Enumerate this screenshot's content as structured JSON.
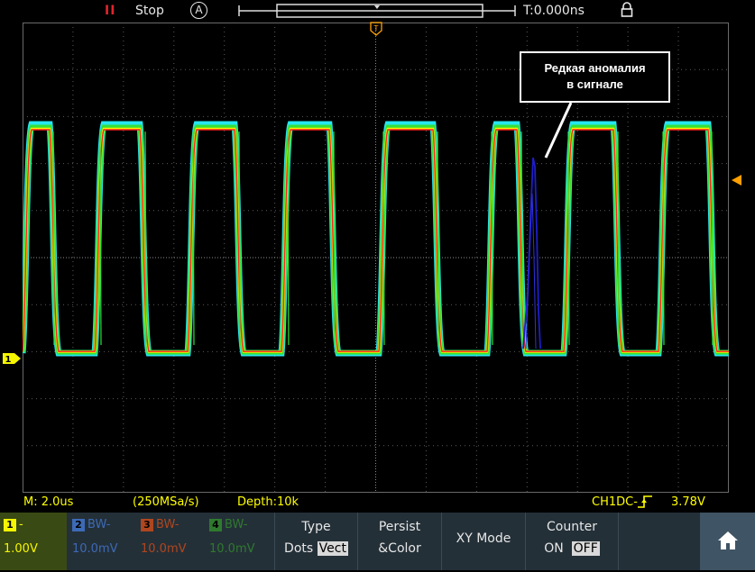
{
  "topbar": {
    "run_indicator": "II",
    "status": "Stop",
    "acq_mode": "A",
    "time_offset": "T:0.000ns",
    "lock_icon": "lock-icon"
  },
  "annotation": {
    "line1": "Редкая аномалия",
    "line2": "в сигнале"
  },
  "bottom_info": {
    "timebase": "M: 2.0us",
    "sample_rate": "(250MSa/s)",
    "depth": "Depth:10k",
    "trigger_info": "CH1DC-",
    "trigger_level": "3.78V"
  },
  "channels": [
    {
      "num": "1",
      "line1": "-",
      "line2": "1.00V",
      "color": "#f5f500",
      "bg": "#3a4a14"
    },
    {
      "num": "2",
      "line1": "BW-",
      "line2": "10.0mV",
      "color": "#3c6ab6",
      "bg": "#243038"
    },
    {
      "num": "3",
      "line1": "BW-",
      "line2": "10.0mV",
      "color": "#b0461f",
      "bg": "#243038"
    },
    {
      "num": "4",
      "line1": "BW-",
      "line2": "10.0mV",
      "color": "#2f7a2f",
      "bg": "#243038"
    }
  ],
  "menu": {
    "type_label": "Type",
    "type_dots": "Dots",
    "type_vect": "Vect",
    "persist_line1": "Persist",
    "persist_line2": "&Color",
    "xy_mode": "XY Mode",
    "counter_label": "Counter",
    "counter_on": "ON",
    "counter_off": "OFF",
    "home_icon": "home-icon"
  },
  "markers": {
    "ch1_ground": "1",
    "trigger_top": "T"
  },
  "colors": {
    "ch1": "#f5f500",
    "persist_cyan": "#25e6f0",
    "persist_green": "#35e035",
    "persist_red": "#ff2020",
    "anomaly": "#1e1ec8",
    "trigger_marker": "#ffa000"
  }
}
